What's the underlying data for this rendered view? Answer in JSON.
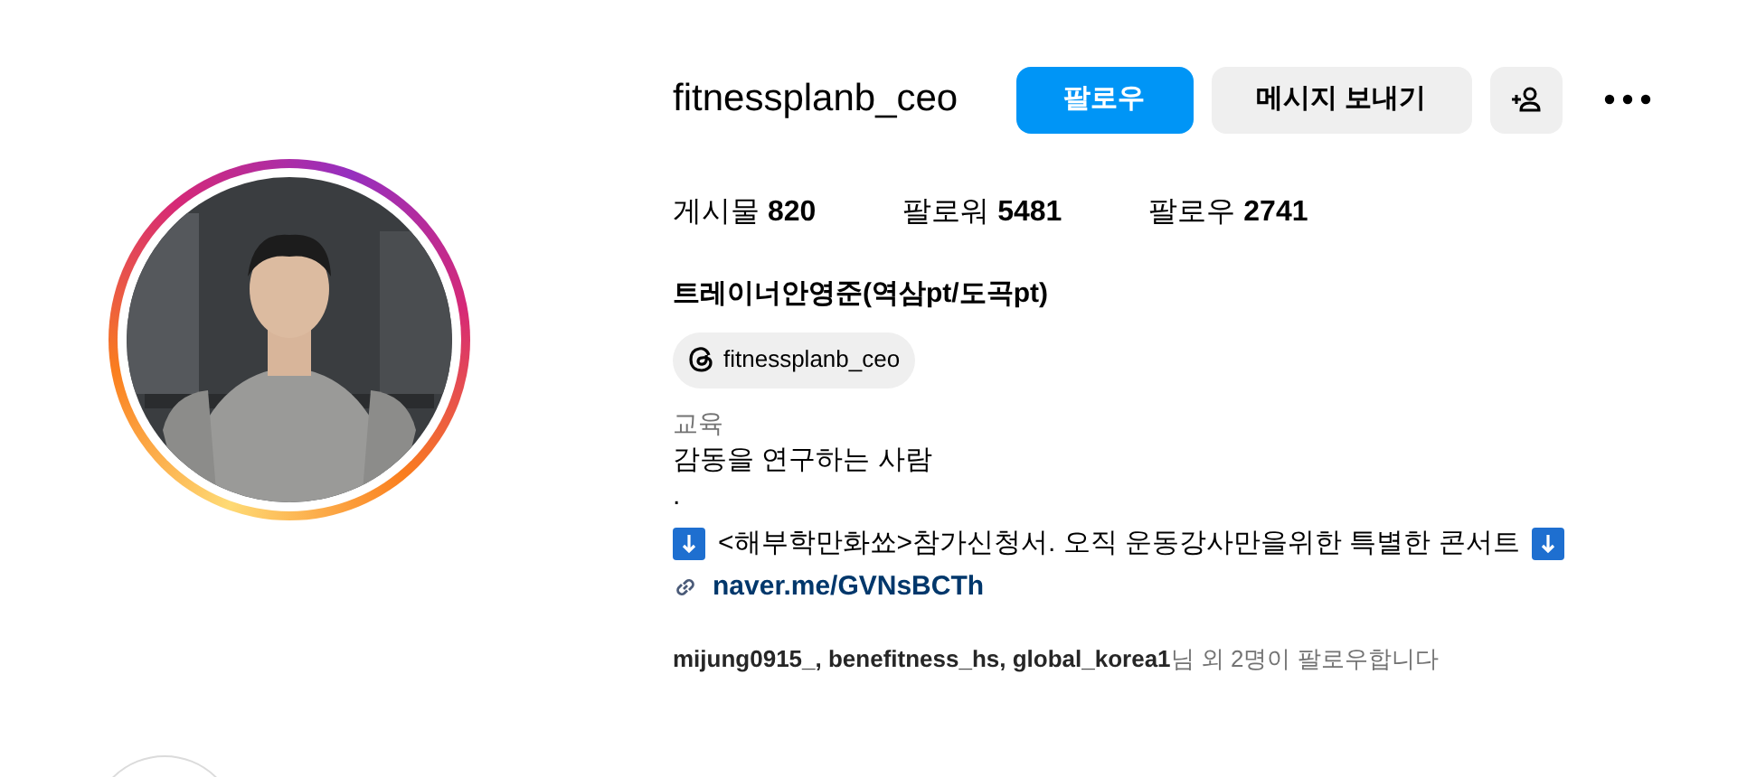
{
  "profile": {
    "username": "fitnessplanb_ceo",
    "buttons": [
      {
        "kind": "primary",
        "label": "팔로우"
      },
      {
        "kind": "secondary",
        "label": "메시지 보내기"
      }
    ],
    "stats": [
      {
        "label": "게시물",
        "value": "820"
      },
      {
        "label": "팔로워",
        "value": "5481"
      },
      {
        "label": "팔로우",
        "value": "2741"
      }
    ],
    "full_name": "트레이너안영준(역삼pt/도곡pt)",
    "threads_handle": "fitnessplanb_ceo",
    "category": "교육",
    "bio_lines": [
      "감동을 연구하는 사람",
      "."
    ],
    "announcement": "<해부학만화쑈>참가신청서. 오직 운동강사만을위한 특별한 콘서트",
    "link": "naver.me/GVNsBCTh",
    "followed_by_names": "mijung0915_, benefitness_hs, global_korea1",
    "followed_by_suffix": "님 외 2명이 팔로우합니다"
  }
}
